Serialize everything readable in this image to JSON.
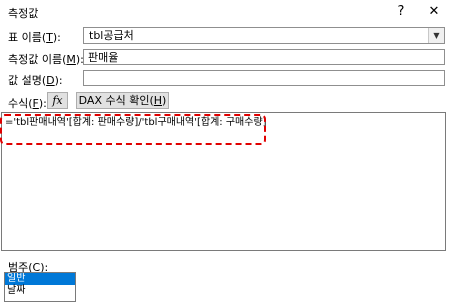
{
  "window": {
    "title": "측정값",
    "help_glyph": "?",
    "close_glyph": "✕"
  },
  "table_name": {
    "label": "표 이름(",
    "hotkey": "T",
    "label_end": "):",
    "value": "tbl공급처"
  },
  "measure_name": {
    "label": "측정값 이름(",
    "hotkey": "M",
    "label_end": "):",
    "value": "판매율"
  },
  "description": {
    "label": "값 설명(",
    "hotkey": "D",
    "label_end": "):",
    "value": ""
  },
  "formula": {
    "label": "수식(",
    "hotkey": "F",
    "label_end": "):",
    "fx_label": "fx",
    "dax_check_label": "DAX 수식 확인(",
    "dax_check_hotkey": "H",
    "dax_check_end": ")",
    "text": "='tbl판매내역'[합계: 판매수량]/'tbl구매내역'[합계: 구매수량]"
  },
  "category": {
    "label": "범주(",
    "hotkey": "C",
    "label_end": "):",
    "items": [
      "일반",
      "날짜"
    ],
    "selected": "일반"
  }
}
